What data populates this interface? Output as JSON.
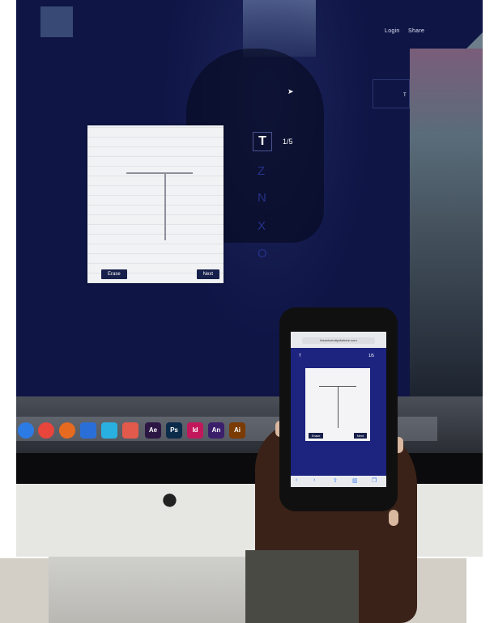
{
  "monitor_app": {
    "nav": {
      "login": "Login",
      "share": "Share"
    },
    "minimap_letter": "T",
    "current_letter": "T",
    "progress": "1/5",
    "upcoming_letters": [
      "Z",
      "N",
      "X",
      "O"
    ],
    "pad": {
      "erase_label": "Erase",
      "next_label": "Next"
    }
  },
  "dock_apps": [
    "Ae",
    "Ps",
    "Id",
    "An",
    "Ai"
  ],
  "phone_app": {
    "url": "theuniversityofwhere.com",
    "current_letter": "T",
    "progress": "1/5",
    "erase_label": "Erase",
    "next_label": "Next"
  },
  "colors": {
    "screen_bg": "#0f1545",
    "button_bg": "#16204a",
    "queue_letter": "#27328a",
    "phone_screen_bg": "#1c2480"
  },
  "icons": [
    "cursor-arrow-icon",
    "apple-logo-icon",
    "safari-icon",
    "chrome-icon",
    "firefox-icon"
  ]
}
